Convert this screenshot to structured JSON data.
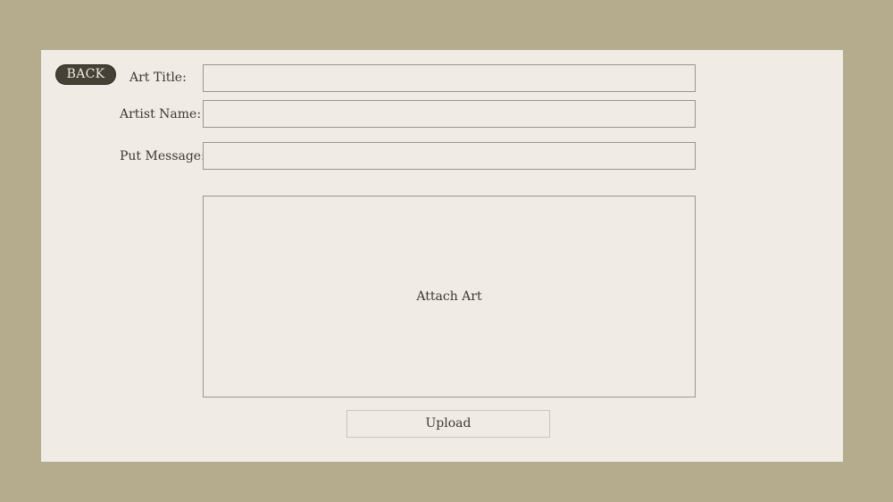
{
  "back_button": {
    "label": "BACK"
  },
  "form": {
    "art_title": {
      "label": "Art Title:",
      "value": "",
      "placeholder": ""
    },
    "artist_name": {
      "label": "Artist Name:",
      "value": "",
      "placeholder": ""
    },
    "message": {
      "label": "Put Message:",
      "value": "",
      "placeholder": ""
    },
    "attach": {
      "label": "Attach Art"
    },
    "upload": {
      "label": "Upload"
    }
  },
  "colors": {
    "background": "#b4ac8c",
    "panel": "#f0ebe5",
    "back_button": "#454134",
    "text": "#3a3a30",
    "border": "#9a968c"
  }
}
